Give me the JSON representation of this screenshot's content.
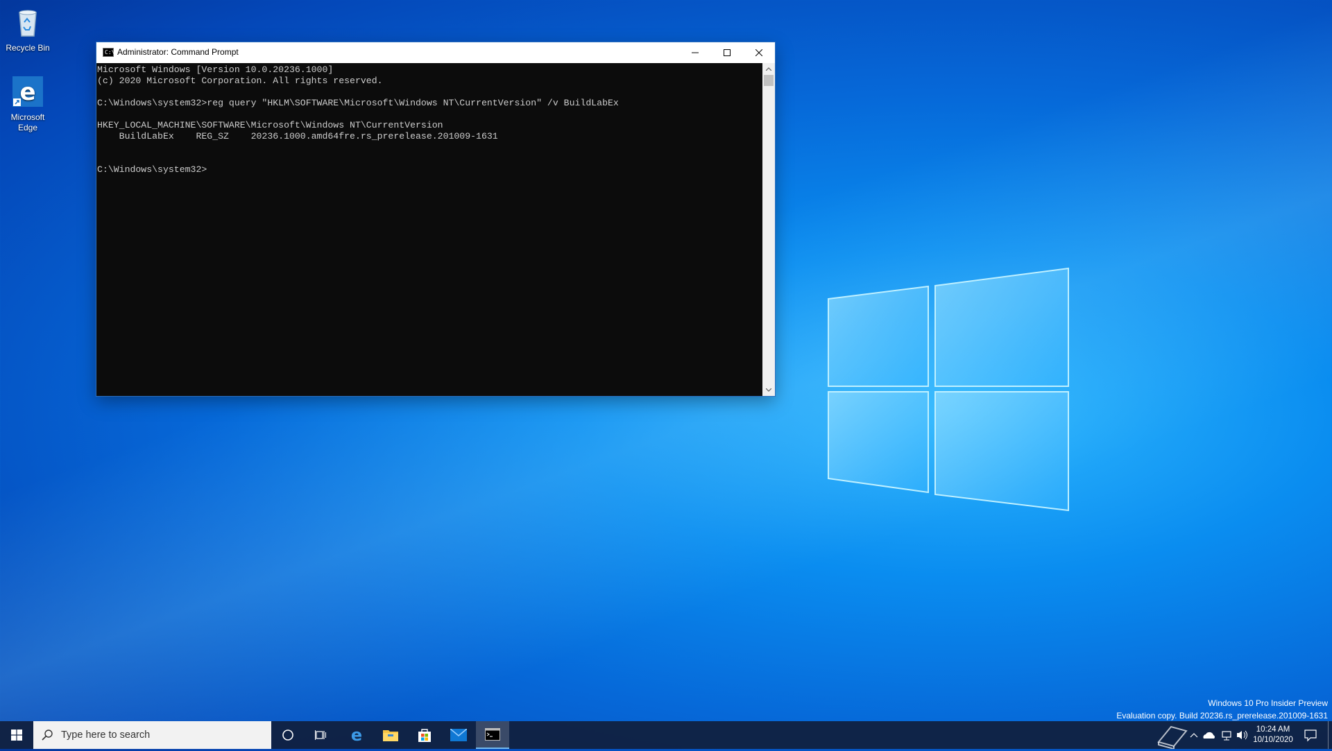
{
  "desktop": {
    "icons": [
      {
        "label": "Recycle Bin"
      },
      {
        "label": "Microsoft Edge"
      }
    ]
  },
  "window": {
    "title": "Administrator: Command Prompt",
    "console_lines": [
      "Microsoft Windows [Version 10.0.20236.1000]",
      "(c) 2020 Microsoft Corporation. All rights reserved.",
      "",
      "C:\\Windows\\system32>reg query \"HKLM\\SOFTWARE\\Microsoft\\Windows NT\\CurrentVersion\" /v BuildLabEx",
      "",
      "HKEY_LOCAL_MACHINE\\SOFTWARE\\Microsoft\\Windows NT\\CurrentVersion",
      "    BuildLabEx    REG_SZ    20236.1000.amd64fre.rs_prerelease.201009-1631",
      "",
      "",
      "C:\\Windows\\system32>"
    ]
  },
  "watermark": {
    "line1": "Windows 10 Pro Insider Preview",
    "line2": "Evaluation copy. Build 20236.rs_prerelease.201009-1631"
  },
  "taskbar": {
    "search_placeholder": "Type here to search",
    "clock_time": "10:24 AM",
    "clock_date": "10/10/2020"
  },
  "colors": {
    "console_bg": "#0c0c0c",
    "console_fg": "#cccccc",
    "taskbar_bg": "#101e3c"
  }
}
